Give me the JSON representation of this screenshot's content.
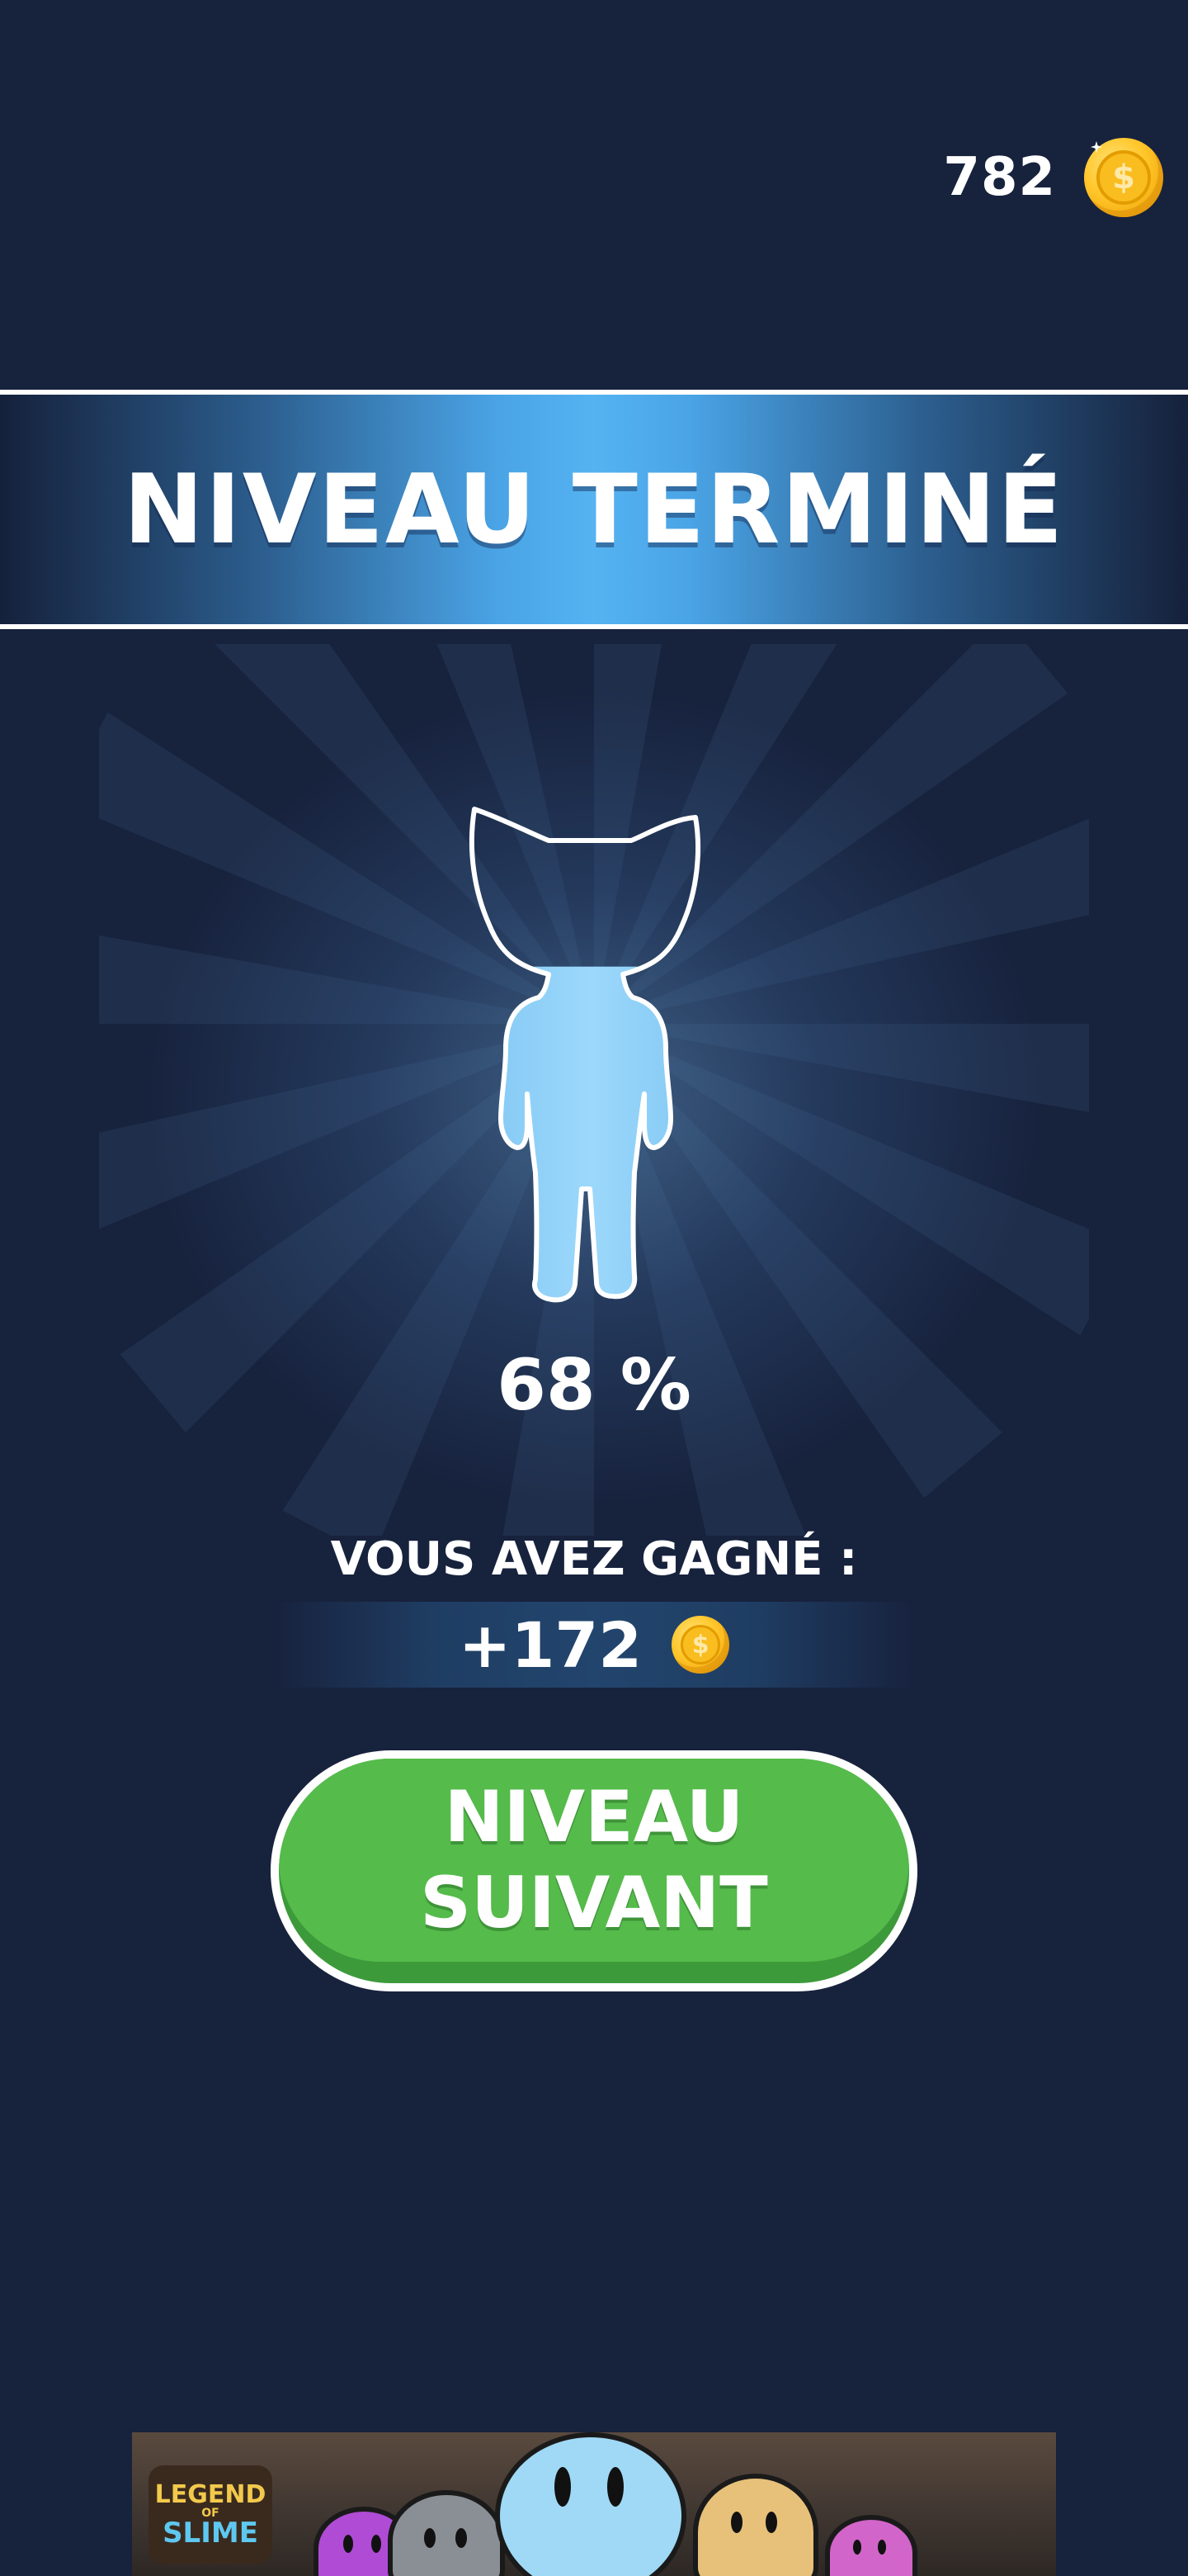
{
  "hud": {
    "coins": "782",
    "coin_icon": "gold-coin-icon"
  },
  "banner": {
    "title": "NIVEAU TERMINÉ"
  },
  "result": {
    "fill_percent": 68,
    "percent_label": "68 %",
    "character_icon": "cat-character-silhouette"
  },
  "reward": {
    "label": "VOUS AVEZ GAGNÉ :",
    "amount": "+172",
    "coin_icon": "gold-coin-icon"
  },
  "next_button": {
    "line1": "NIVEAU",
    "line2": "SUIVANT"
  },
  "ad": {
    "logo_line1": "LEGEND",
    "logo_line2": "OF",
    "logo_line3": "SLIME"
  },
  "colors": {
    "background": "#17223d",
    "banner_blue": "#55b3f2",
    "button_green": "#55bb4b",
    "character_blue": "#8fd0f7",
    "coin_gold": "#ffc62a"
  }
}
